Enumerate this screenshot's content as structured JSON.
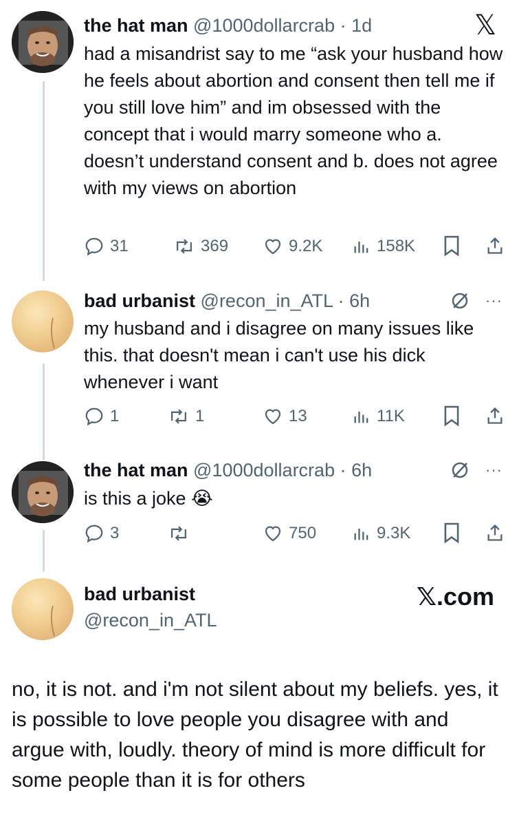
{
  "tweets": [
    {
      "name": "the hat man",
      "handle": "@1000dollarcrab",
      "time": "1d",
      "text": "had a misandrist say to me “ask your husband how he feels about abortion and consent then tell me if you still love him” and im obsessed with the concept that i would marry someone who a. doesn’t understand consent and b. does not agree with my views on abortion",
      "replies": "31",
      "reposts": "369",
      "likes": "9.2K",
      "views": "158K"
    },
    {
      "name": "bad urbanist",
      "handle": "@recon_in_ATL",
      "time": "6h",
      "text": "my husband and i disagree on many issues like this. that doesn't mean i can't use his dick whenever i want",
      "replies": "1",
      "reposts": "1",
      "likes": "13",
      "views": "11K"
    },
    {
      "name": "the hat man",
      "handle": "@1000dollarcrab",
      "time": "6h",
      "text": "is this a joke 😭",
      "replies": "3",
      "reposts": "",
      "likes": "750",
      "views": "9.3K"
    }
  ],
  "separator": "·",
  "more_label": "···",
  "final": {
    "name": "bad urbanist",
    "handle": "@recon_in_ATL",
    "brand": "𝕏.com",
    "text": "no, it is not. and i'm not silent about my beliefs. yes, it is possible to love people you disagree with and argue with, loudly. theory of mind is more difficult for some people than it is for others"
  },
  "x_logo": "𝕏",
  "colors": {
    "text": "#0f1419",
    "secondary": "#536471",
    "thread_line": "#cfd9de"
  }
}
